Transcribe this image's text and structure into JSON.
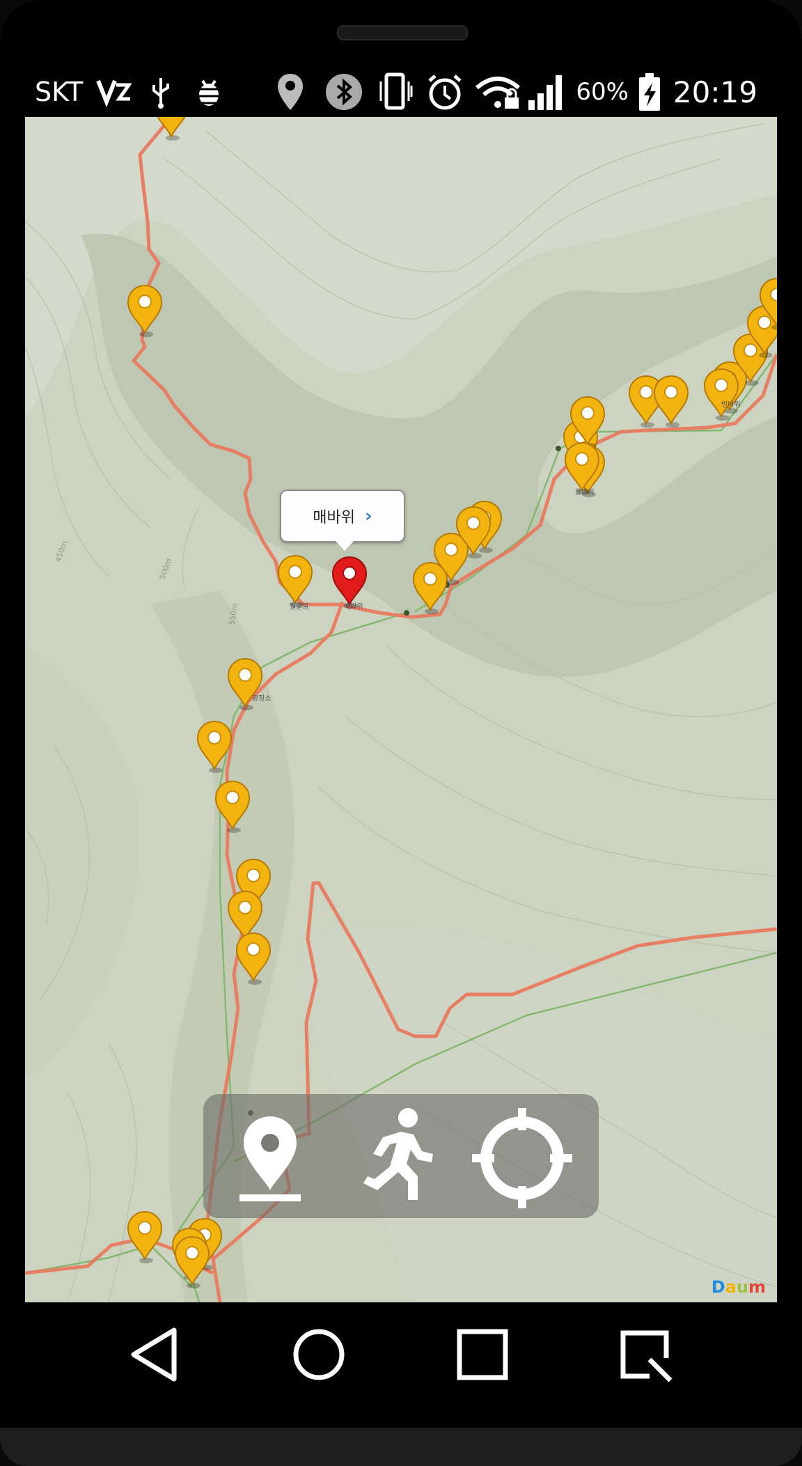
{
  "status_bar": {
    "carrier": "SKT",
    "battery_percent": "60%",
    "time": "20:19",
    "icons": [
      "volte-icon",
      "usb-icon",
      "debug-bug-icon",
      "location-icon",
      "bluetooth-icon",
      "vibrate-icon",
      "alarm-icon",
      "wifi-locked-icon",
      "signal-icon",
      "battery-charging-icon"
    ]
  },
  "map": {
    "selected_poi_callout": "매바위",
    "attribution": "Daum",
    "colors": {
      "background": "#cfd5c3",
      "ridge": "#b9c2ad",
      "trail": "#e8755a",
      "path_green": "#7fb46e",
      "marker_yellow": "#f3b410",
      "marker_red": "#e21b1b"
    }
  },
  "toolbar": {
    "buttons": [
      {
        "name": "place-marker-button",
        "icon": "place-marker-icon"
      },
      {
        "name": "walking-tracker-button",
        "icon": "walking-person-icon"
      },
      {
        "name": "my-location-button",
        "icon": "crosshair-icon"
      }
    ]
  },
  "nav_bar": {
    "buttons": [
      "back-icon",
      "home-icon",
      "recents-icon",
      "quick-memo-icon"
    ]
  }
}
